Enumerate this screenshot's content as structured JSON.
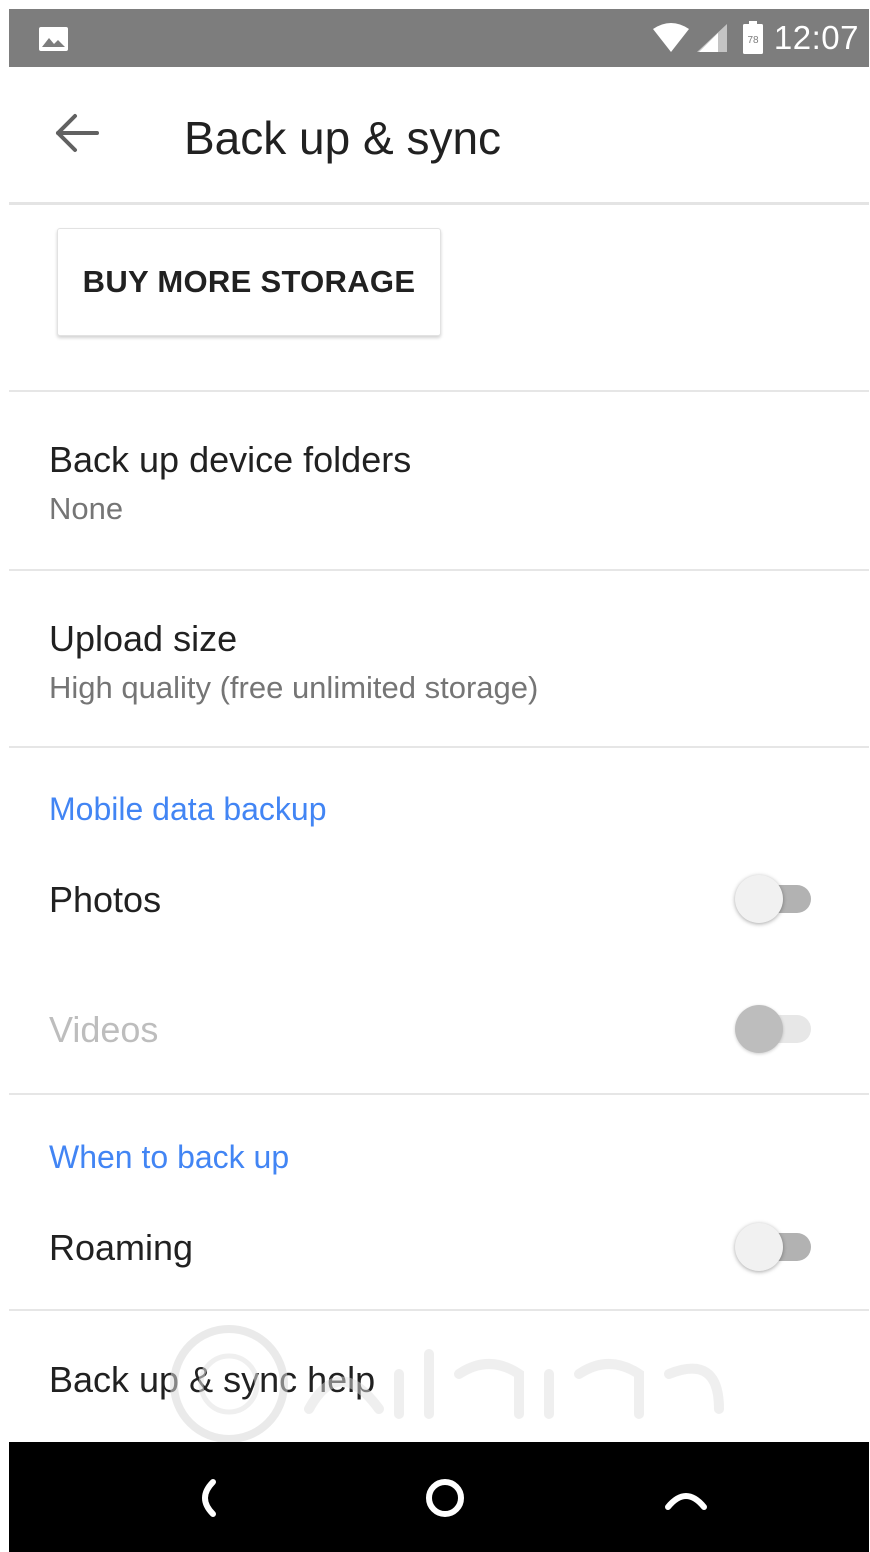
{
  "status_bar": {
    "time": "12:07",
    "icons": [
      "image-icon",
      "wifi-icon",
      "signal-icon",
      "battery-icon"
    ],
    "battery_label": "78"
  },
  "app_bar": {
    "title": "Back up & sync",
    "back_icon": "arrow-back-icon"
  },
  "storage": {
    "buy_button_label": "BUY MORE STORAGE"
  },
  "settings": {
    "device_folders": {
      "title": "Back up device folders",
      "value": "None"
    },
    "upload_size": {
      "title": "Upload size",
      "value": "High quality (free unlimited storage)"
    },
    "mobile_data": {
      "header": "Mobile data backup",
      "photos": {
        "label": "Photos",
        "on": false,
        "enabled": true
      },
      "videos": {
        "label": "Videos",
        "on": false,
        "enabled": false
      }
    },
    "when_to_back_up": {
      "header": "When to back up",
      "roaming": {
        "label": "Roaming",
        "on": false,
        "enabled": true
      }
    },
    "help": {
      "title": "Back up & sync help"
    }
  },
  "nav_bar": {
    "icons": [
      "nav-back-icon",
      "nav-home-icon",
      "nav-recents-icon"
    ]
  },
  "colors": {
    "status_bar": "#7d7d7d",
    "accent": "#4285f4",
    "primary_text": "#212121",
    "secondary_text": "#757575",
    "disabled_text": "#bdbdbd",
    "nav_bar": "#000000"
  }
}
